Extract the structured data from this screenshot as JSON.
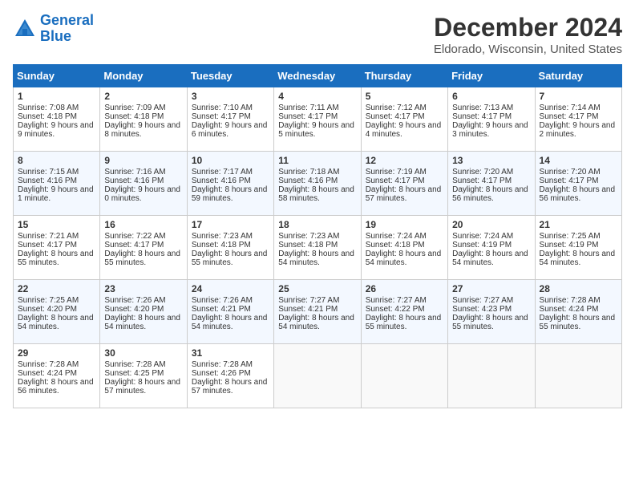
{
  "header": {
    "logo_line1": "General",
    "logo_line2": "Blue",
    "title": "December 2024",
    "subtitle": "Eldorado, Wisconsin, United States"
  },
  "weekdays": [
    "Sunday",
    "Monday",
    "Tuesday",
    "Wednesday",
    "Thursday",
    "Friday",
    "Saturday"
  ],
  "weeks": [
    [
      {
        "day": "1",
        "rise": "Sunrise: 7:08 AM",
        "set": "Sunset: 4:18 PM",
        "daylight": "Daylight: 9 hours and 9 minutes."
      },
      {
        "day": "2",
        "rise": "Sunrise: 7:09 AM",
        "set": "Sunset: 4:18 PM",
        "daylight": "Daylight: 9 hours and 8 minutes."
      },
      {
        "day": "3",
        "rise": "Sunrise: 7:10 AM",
        "set": "Sunset: 4:17 PM",
        "daylight": "Daylight: 9 hours and 6 minutes."
      },
      {
        "day": "4",
        "rise": "Sunrise: 7:11 AM",
        "set": "Sunset: 4:17 PM",
        "daylight": "Daylight: 9 hours and 5 minutes."
      },
      {
        "day": "5",
        "rise": "Sunrise: 7:12 AM",
        "set": "Sunset: 4:17 PM",
        "daylight": "Daylight: 9 hours and 4 minutes."
      },
      {
        "day": "6",
        "rise": "Sunrise: 7:13 AM",
        "set": "Sunset: 4:17 PM",
        "daylight": "Daylight: 9 hours and 3 minutes."
      },
      {
        "day": "7",
        "rise": "Sunrise: 7:14 AM",
        "set": "Sunset: 4:17 PM",
        "daylight": "Daylight: 9 hours and 2 minutes."
      }
    ],
    [
      {
        "day": "8",
        "rise": "Sunrise: 7:15 AM",
        "set": "Sunset: 4:16 PM",
        "daylight": "Daylight: 9 hours and 1 minute."
      },
      {
        "day": "9",
        "rise": "Sunrise: 7:16 AM",
        "set": "Sunset: 4:16 PM",
        "daylight": "Daylight: 9 hours and 0 minutes."
      },
      {
        "day": "10",
        "rise": "Sunrise: 7:17 AM",
        "set": "Sunset: 4:16 PM",
        "daylight": "Daylight: 8 hours and 59 minutes."
      },
      {
        "day": "11",
        "rise": "Sunrise: 7:18 AM",
        "set": "Sunset: 4:16 PM",
        "daylight": "Daylight: 8 hours and 58 minutes."
      },
      {
        "day": "12",
        "rise": "Sunrise: 7:19 AM",
        "set": "Sunset: 4:17 PM",
        "daylight": "Daylight: 8 hours and 57 minutes."
      },
      {
        "day": "13",
        "rise": "Sunrise: 7:20 AM",
        "set": "Sunset: 4:17 PM",
        "daylight": "Daylight: 8 hours and 56 minutes."
      },
      {
        "day": "14",
        "rise": "Sunrise: 7:20 AM",
        "set": "Sunset: 4:17 PM",
        "daylight": "Daylight: 8 hours and 56 minutes."
      }
    ],
    [
      {
        "day": "15",
        "rise": "Sunrise: 7:21 AM",
        "set": "Sunset: 4:17 PM",
        "daylight": "Daylight: 8 hours and 55 minutes."
      },
      {
        "day": "16",
        "rise": "Sunrise: 7:22 AM",
        "set": "Sunset: 4:17 PM",
        "daylight": "Daylight: 8 hours and 55 minutes."
      },
      {
        "day": "17",
        "rise": "Sunrise: 7:23 AM",
        "set": "Sunset: 4:18 PM",
        "daylight": "Daylight: 8 hours and 55 minutes."
      },
      {
        "day": "18",
        "rise": "Sunrise: 7:23 AM",
        "set": "Sunset: 4:18 PM",
        "daylight": "Daylight: 8 hours and 54 minutes."
      },
      {
        "day": "19",
        "rise": "Sunrise: 7:24 AM",
        "set": "Sunset: 4:18 PM",
        "daylight": "Daylight: 8 hours and 54 minutes."
      },
      {
        "day": "20",
        "rise": "Sunrise: 7:24 AM",
        "set": "Sunset: 4:19 PM",
        "daylight": "Daylight: 8 hours and 54 minutes."
      },
      {
        "day": "21",
        "rise": "Sunrise: 7:25 AM",
        "set": "Sunset: 4:19 PM",
        "daylight": "Daylight: 8 hours and 54 minutes."
      }
    ],
    [
      {
        "day": "22",
        "rise": "Sunrise: 7:25 AM",
        "set": "Sunset: 4:20 PM",
        "daylight": "Daylight: 8 hours and 54 minutes."
      },
      {
        "day": "23",
        "rise": "Sunrise: 7:26 AM",
        "set": "Sunset: 4:20 PM",
        "daylight": "Daylight: 8 hours and 54 minutes."
      },
      {
        "day": "24",
        "rise": "Sunrise: 7:26 AM",
        "set": "Sunset: 4:21 PM",
        "daylight": "Daylight: 8 hours and 54 minutes."
      },
      {
        "day": "25",
        "rise": "Sunrise: 7:27 AM",
        "set": "Sunset: 4:21 PM",
        "daylight": "Daylight: 8 hours and 54 minutes."
      },
      {
        "day": "26",
        "rise": "Sunrise: 7:27 AM",
        "set": "Sunset: 4:22 PM",
        "daylight": "Daylight: 8 hours and 55 minutes."
      },
      {
        "day": "27",
        "rise": "Sunrise: 7:27 AM",
        "set": "Sunset: 4:23 PM",
        "daylight": "Daylight: 8 hours and 55 minutes."
      },
      {
        "day": "28",
        "rise": "Sunrise: 7:28 AM",
        "set": "Sunset: 4:24 PM",
        "daylight": "Daylight: 8 hours and 55 minutes."
      }
    ],
    [
      {
        "day": "29",
        "rise": "Sunrise: 7:28 AM",
        "set": "Sunset: 4:24 PM",
        "daylight": "Daylight: 8 hours and 56 minutes."
      },
      {
        "day": "30",
        "rise": "Sunrise: 7:28 AM",
        "set": "Sunset: 4:25 PM",
        "daylight": "Daylight: 8 hours and 57 minutes."
      },
      {
        "day": "31",
        "rise": "Sunrise: 7:28 AM",
        "set": "Sunset: 4:26 PM",
        "daylight": "Daylight: 8 hours and 57 minutes."
      },
      null,
      null,
      null,
      null
    ]
  ]
}
